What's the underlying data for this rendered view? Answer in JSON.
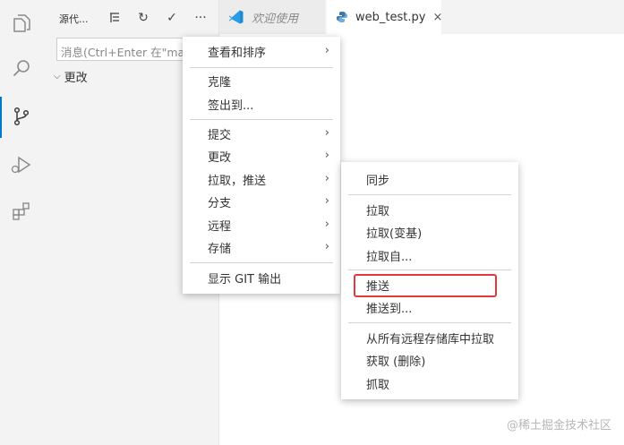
{
  "activity_bar": {
    "icons": [
      "files-icon",
      "search-icon",
      "source-control-icon",
      "run-debug-icon",
      "extensions-icon"
    ]
  },
  "sidebar": {
    "title": "源代...",
    "commit_placeholder": "消息(Ctrl+Enter 在\"master\"提交)",
    "changes_label": "更改"
  },
  "tabs": [
    {
      "label": "欢迎使用"
    },
    {
      "label": "web_test.py",
      "close": "×"
    }
  ],
  "main_menu": {
    "items": [
      {
        "label": "查看和排序",
        "submenu": true
      },
      {
        "label": "克隆",
        "submenu": false
      },
      {
        "label": "签出到...",
        "submenu": false
      },
      {
        "label": "提交",
        "submenu": true
      },
      {
        "label": "更改",
        "submenu": true
      },
      {
        "label": "拉取，推送",
        "submenu": true
      },
      {
        "label": "分支",
        "submenu": true
      },
      {
        "label": "远程",
        "submenu": true
      },
      {
        "label": "存储",
        "submenu": true
      },
      {
        "label": "显示 GIT 输出",
        "submenu": false
      }
    ]
  },
  "sub_menu": {
    "items": [
      {
        "label": "同步"
      },
      {
        "label": "拉取"
      },
      {
        "label": "拉取(变基)"
      },
      {
        "label": "拉取自..."
      },
      {
        "label": "推送"
      },
      {
        "label": "推送到..."
      },
      {
        "label": "从所有远程存储库中拉取"
      },
      {
        "label": "获取 (删除)"
      },
      {
        "label": "抓取"
      }
    ],
    "highlighted": "推送",
    "highlight_color": "#e4393c"
  },
  "watermark": "@稀土掘金技术社区",
  "colors": {
    "accent": "#007acc",
    "python_icon": "#3c78aa",
    "vscode_icon": "#1f8ad2"
  }
}
